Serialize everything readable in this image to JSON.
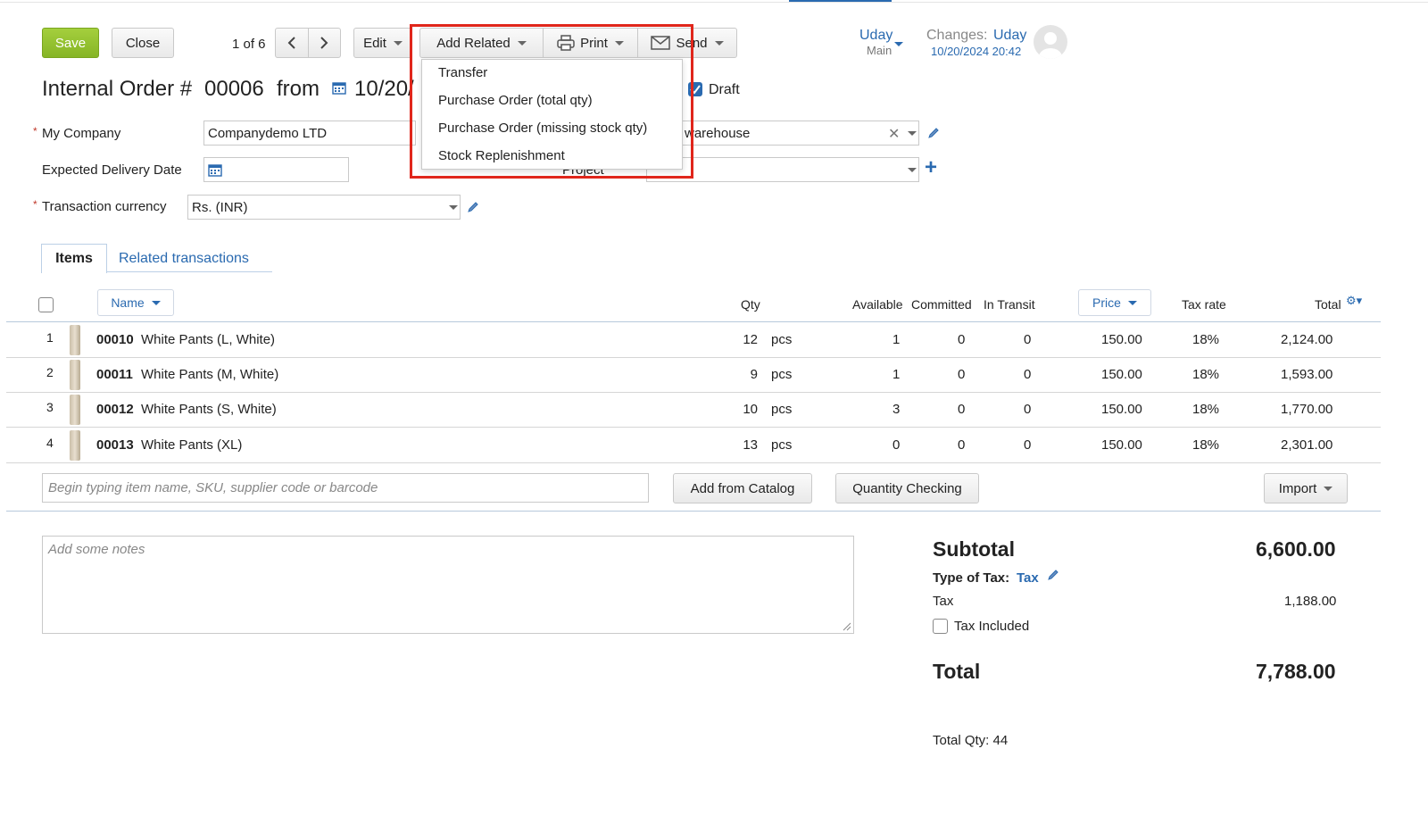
{
  "toolbar": {
    "save_label": "Save",
    "close_label": "Close",
    "pager": "1 of 6",
    "edit_label": "Edit",
    "add_related_label": "Add Related",
    "print_label": "Print",
    "send_label": "Send"
  },
  "user": {
    "name": "Uday",
    "role": "Main",
    "changes_label": "Changes:",
    "changes_user": "Uday",
    "changes_time": "10/20/2024 20:42"
  },
  "dropdown": {
    "items": [
      "Transfer",
      "Purchase Order (total qty)",
      "Purchase Order (missing stock qty)",
      "Stock Replenishment"
    ]
  },
  "header": {
    "title_prefix": "Internal Order #",
    "number": "00006",
    "from": "from",
    "date_partial": "10/20/",
    "draft_label": "Draft"
  },
  "form": {
    "my_company_label": "My Company",
    "my_company_value": "Companydemo LTD",
    "warehouse_value": "warehouse",
    "expected_delivery_label": "Expected Delivery Date",
    "project_label": "Project",
    "currency_label": "Transaction currency",
    "currency_value": "Rs. (INR)"
  },
  "tabs": {
    "items": "Items",
    "related": "Related transactions"
  },
  "table": {
    "headers": {
      "name": "Name",
      "qty": "Qty",
      "available": "Available",
      "committed": "Committed",
      "in_transit": "In Transit",
      "price": "Price",
      "tax_rate": "Tax rate",
      "total": "Total"
    },
    "rows": [
      {
        "num": "1",
        "code": "00010",
        "name": "White Pants (L, White)",
        "qty": "12",
        "unit": "pcs",
        "available": "1",
        "committed": "0",
        "in_transit": "0",
        "price": "150.00",
        "tax": "18%",
        "total": "2,124.00"
      },
      {
        "num": "2",
        "code": "00011",
        "name": "White Pants (M, White)",
        "qty": "9",
        "unit": "pcs",
        "available": "1",
        "committed": "0",
        "in_transit": "0",
        "price": "150.00",
        "tax": "18%",
        "total": "1,593.00"
      },
      {
        "num": "3",
        "code": "00012",
        "name": "White Pants (S, White)",
        "qty": "10",
        "unit": "pcs",
        "available": "3",
        "committed": "0",
        "in_transit": "0",
        "price": "150.00",
        "tax": "18%",
        "total": "1,770.00"
      },
      {
        "num": "4",
        "code": "00013",
        "name": "White Pants (XL)",
        "qty": "13",
        "unit": "pcs",
        "available": "0",
        "committed": "0",
        "in_transit": "0",
        "price": "150.00",
        "tax": "18%",
        "total": "2,301.00"
      }
    ]
  },
  "item_search": {
    "placeholder": "Begin typing item name, SKU, supplier code or barcode",
    "add_from_catalog": "Add from Catalog",
    "quantity_checking": "Quantity Checking",
    "import": "Import"
  },
  "notes": {
    "placeholder": "Add some notes"
  },
  "summary": {
    "subtotal_label": "Subtotal",
    "subtotal_value": "6,600.00",
    "type_of_tax_label": "Type of Tax:",
    "type_of_tax_value": "Tax",
    "tax_label": "Tax",
    "tax_value": "1,188.00",
    "tax_included_label": "Tax Included",
    "total_label": "Total",
    "total_value": "7,788.00",
    "total_qty": "Total Qty: 44"
  },
  "colors": {
    "save_green": "#8dbb2a",
    "link_blue": "#2a6ab0",
    "highlight_red": "#e0261b"
  }
}
